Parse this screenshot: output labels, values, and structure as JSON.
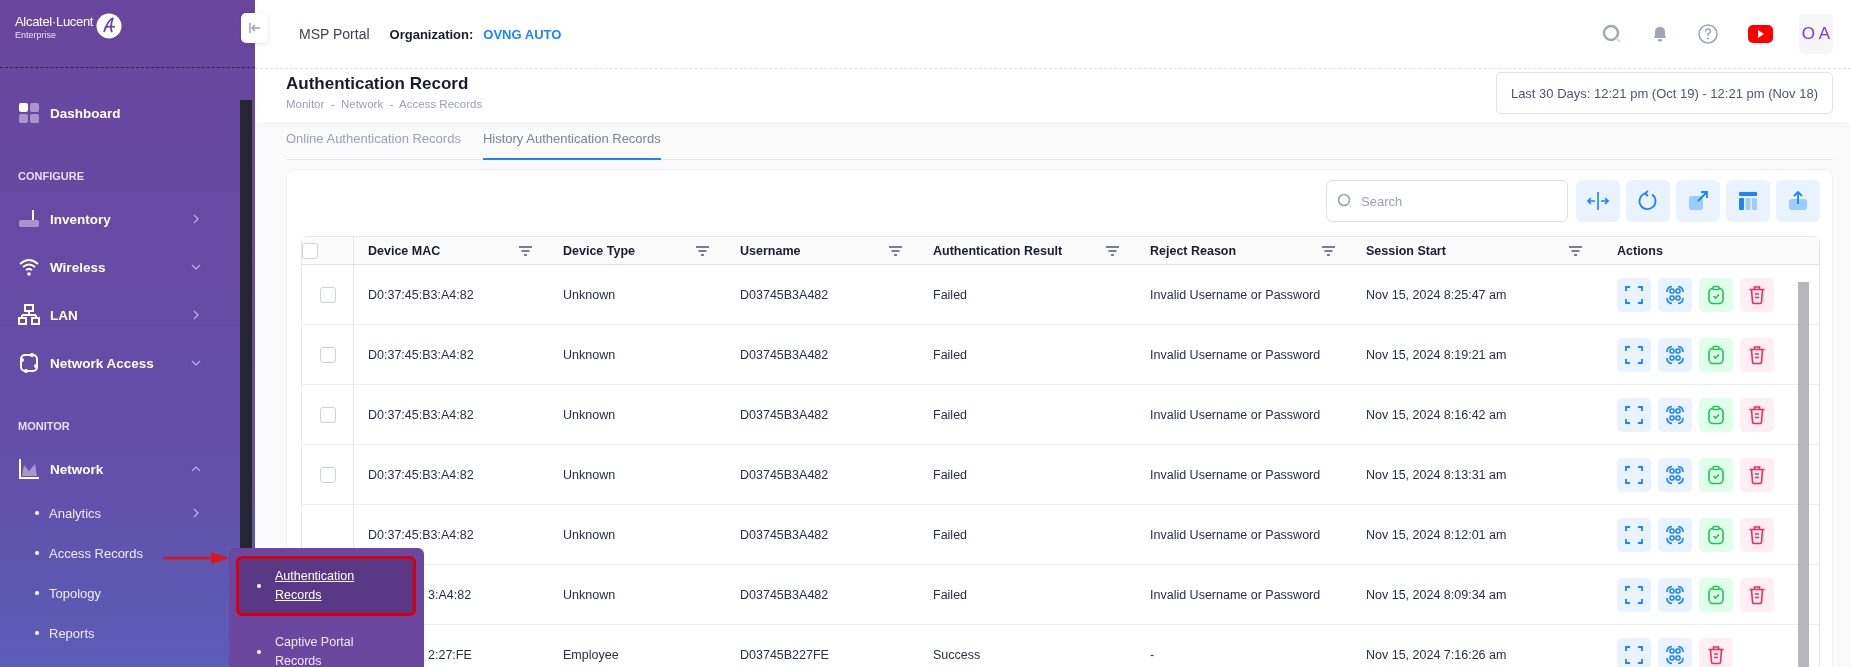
{
  "sidebar": {
    "logo": {
      "brand": "Alcatel·Lucent",
      "subtitle": "Enterprise"
    },
    "sections": [
      {
        "items": [
          {
            "label": "Dashboard",
            "kind": "link"
          }
        ]
      },
      {
        "heading": "CONFIGURE",
        "items": [
          {
            "label": "Inventory",
            "kind": "submenu"
          },
          {
            "label": "Wireless",
            "kind": "collapsible",
            "expanded": false
          },
          {
            "label": "LAN",
            "kind": "submenu"
          },
          {
            "label": "Network Access",
            "kind": "collapsible",
            "expanded": false
          }
        ]
      },
      {
        "heading": "MONITOR",
        "items": [
          {
            "label": "Network",
            "kind": "collapsible",
            "expanded": true,
            "children": [
              {
                "label": "Analytics",
                "kind": "submenu"
              },
              {
                "label": "Access Records",
                "kind": "link"
              },
              {
                "label": "Topology",
                "kind": "link"
              },
              {
                "label": "Reports",
                "kind": "link"
              }
            ]
          }
        ]
      }
    ]
  },
  "flyout": {
    "items": [
      {
        "label": "Authentication Records",
        "selected": true,
        "callout": true
      },
      {
        "label": "Captive Portal Records",
        "selected": false,
        "callout": false
      }
    ]
  },
  "header": {
    "portal": "MSP Portal",
    "org_label": "Organization:",
    "org_name": "OVNG AUTO",
    "avatar": "O A"
  },
  "page": {
    "title": "Authentication Record",
    "breadcrumb": "Monitor  -  Network  -  Access Records",
    "date_range": "Last 30 Days: 12:21 pm (Oct 19) - 12:21 pm (Nov 18)"
  },
  "tabs": [
    {
      "label": "Online Authentication Records",
      "selected": false
    },
    {
      "label": "History Authentication Records",
      "selected": true
    }
  ],
  "search": {
    "placeholder": "Search"
  },
  "table": {
    "select_all": {
      "checked": false
    },
    "columns": [
      {
        "label": "Device MAC",
        "filter": true
      },
      {
        "label": "Device Type",
        "filter": true
      },
      {
        "label": "Username",
        "filter": true
      },
      {
        "label": "Authentication Result",
        "filter": true
      },
      {
        "label": "Reject Reason",
        "filter": true
      },
      {
        "label": "Session Start",
        "filter": true
      },
      {
        "label": "Actions",
        "filter": false
      }
    ],
    "rows": [
      {
        "checked": false,
        "mac": "D0:37:45:B3:A4:82",
        "type": "Unknown",
        "username": "D03745B3A482",
        "result": "Failed",
        "reason": "Invalid Username or Password",
        "session": "Nov 15, 2024 8:25:47 am",
        "actions": [
          {
            "kind": "expand"
          },
          {
            "kind": "scan"
          },
          {
            "kind": "approve"
          },
          {
            "kind": "delete"
          }
        ]
      },
      {
        "checked": false,
        "mac": "D0:37:45:B3:A4:82",
        "type": "Unknown",
        "username": "D03745B3A482",
        "result": "Failed",
        "reason": "Invalid Username or Password",
        "session": "Nov 15, 2024 8:19:21 am",
        "actions": [
          {
            "kind": "expand"
          },
          {
            "kind": "scan"
          },
          {
            "kind": "approve"
          },
          {
            "kind": "delete"
          }
        ]
      },
      {
        "checked": false,
        "mac": "D0:37:45:B3:A4:82",
        "type": "Unknown",
        "username": "D03745B3A482",
        "result": "Failed",
        "reason": "Invalid Username or Password",
        "session": "Nov 15, 2024 8:16:42 am",
        "actions": [
          {
            "kind": "expand"
          },
          {
            "kind": "scan"
          },
          {
            "kind": "approve"
          },
          {
            "kind": "delete"
          }
        ]
      },
      {
        "checked": false,
        "mac": "D0:37:45:B3:A4:82",
        "type": "Unknown",
        "username": "D03745B3A482",
        "result": "Failed",
        "reason": "Invalid Username or Password",
        "session": "Nov 15, 2024 8:13:31 am",
        "actions": [
          {
            "kind": "expand"
          },
          {
            "kind": "scan"
          },
          {
            "kind": "approve"
          },
          {
            "kind": "delete"
          }
        ]
      },
      {
        "mac": "D0:37:45:B3:A4:82",
        "type": "Unknown",
        "username": "D03745B3A482",
        "result": "Failed",
        "reason": "Invalid Username or Password",
        "session": "Nov 15, 2024 8:12:01 am",
        "actions": [
          {
            "kind": "expand"
          },
          {
            "kind": "scan"
          },
          {
            "kind": "approve"
          },
          {
            "kind": "delete"
          }
        ]
      },
      {
        "mac": "3:A4:82",
        "mac_covered": true,
        "type": "Unknown",
        "username": "D03745B3A482",
        "result": "Failed",
        "reason": "Invalid Username or Password",
        "session": "Nov 15, 2024 8:09:34 am",
        "actions": [
          {
            "kind": "expand"
          },
          {
            "kind": "scan"
          },
          {
            "kind": "approve"
          },
          {
            "kind": "delete"
          }
        ]
      },
      {
        "mac": "2:27:FE",
        "mac_covered": true,
        "type": "Employee",
        "username": "D03745B227FE",
        "result": "Success",
        "reason": "-",
        "session": "Nov 15, 2024 7:16:26 am",
        "actions": [
          {
            "kind": "expand"
          },
          {
            "kind": "scan"
          },
          {
            "kind": "delete"
          }
        ]
      }
    ]
  }
}
